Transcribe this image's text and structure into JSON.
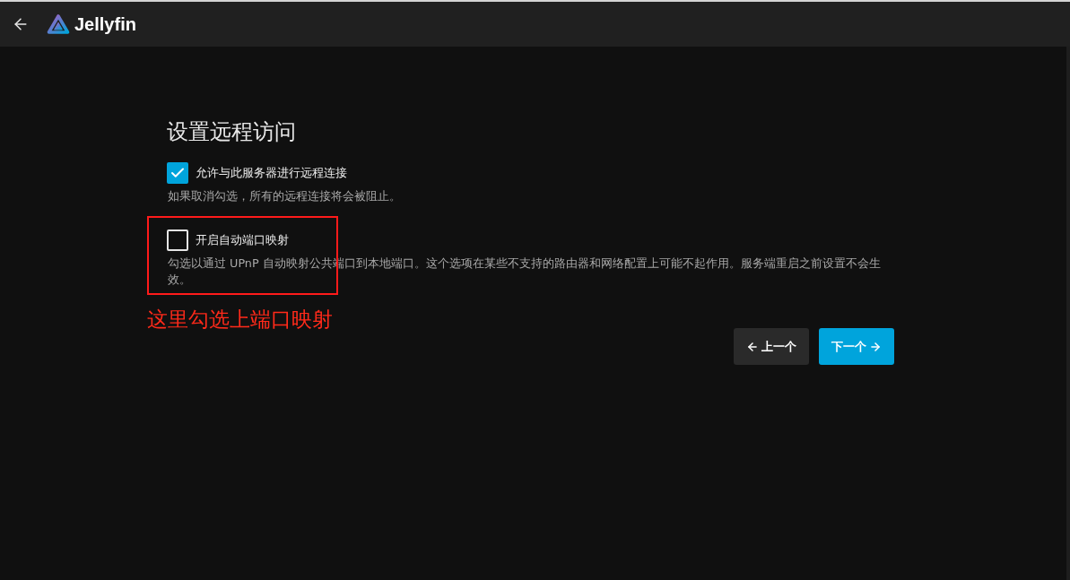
{
  "header": {
    "title": "Jellyfin"
  },
  "page": {
    "title": "设置远程访问",
    "options": [
      {
        "label": "允许与此服务器进行远程连接",
        "checked": true,
        "description": "如果取消勾选，所有的远程连接将会被阻止。",
        "highlighted": false
      },
      {
        "label": "开启自动端口映射",
        "checked": false,
        "description": "勾选以通过 UPnP 自动映射公共端口到本地端口。这个选项在某些不支持的路由器和网络配置上可能不起作用。服务端重启之前设置不会生效。",
        "highlighted": true
      }
    ],
    "annotation": "这里勾选上端口映射",
    "buttons": [
      {
        "label": "上一个",
        "kind": "previous"
      },
      {
        "label": "下一个",
        "kind": "next"
      }
    ]
  }
}
